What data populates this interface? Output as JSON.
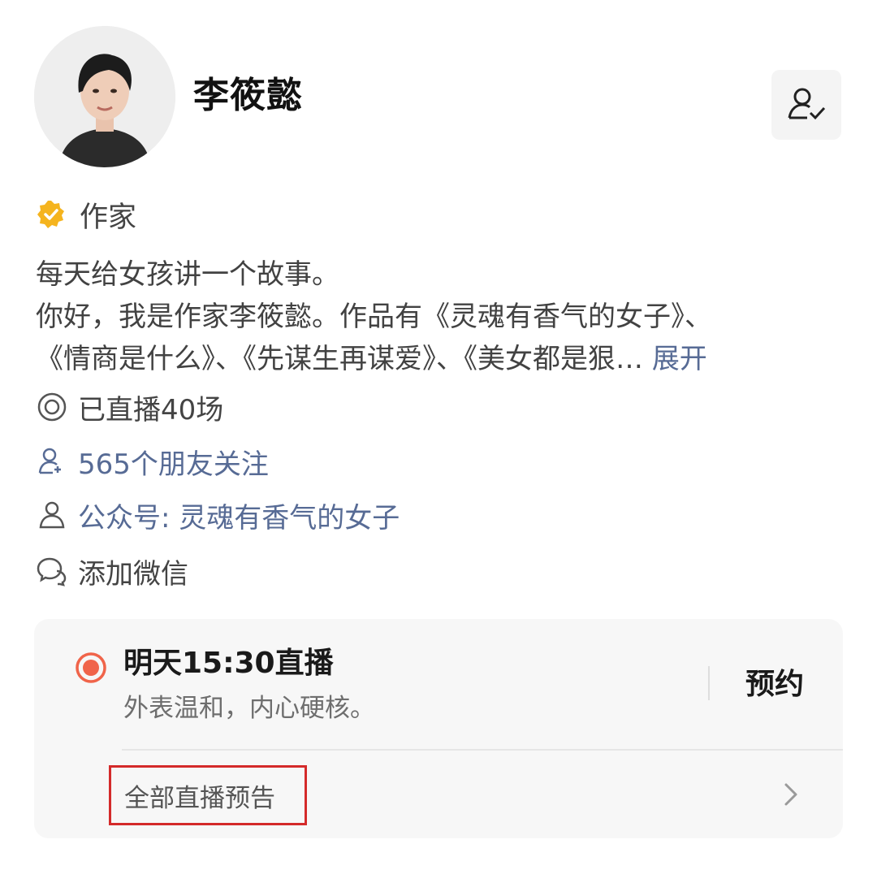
{
  "profile": {
    "name": "李筱懿",
    "avatar_icon": "avatar-photo",
    "follow_icon": "user-check-icon"
  },
  "verification": {
    "icon": "verified-badge-icon",
    "badge_color": "#f5b41e",
    "label": "作家"
  },
  "bio": {
    "line1": "每天给女孩讲一个故事。",
    "line2": "你好，我是作家李筱懿。作品有《灵魂有香气的女子》、",
    "line3": "《情商是什么》、《先谋生再谋爱》、《美女都是狠…",
    "expand_label": "展开"
  },
  "info": {
    "live_count": "已直播40场",
    "friends_follow": "565个朋友关注",
    "official_account": "公众号: 灵魂有香气的女子",
    "add_wechat": "添加微信"
  },
  "live_card": {
    "live_icon": "live-dot-icon",
    "live_color": "#f0644a",
    "title": "明天15:30直播",
    "description": "外表温和，内心硬核。",
    "reserve_label": "预约",
    "all_previews_label": "全部直播预告",
    "highlight_color": "#d42a2a"
  },
  "colors": {
    "link_blue": "#576b95",
    "text_gray": "#444444"
  }
}
